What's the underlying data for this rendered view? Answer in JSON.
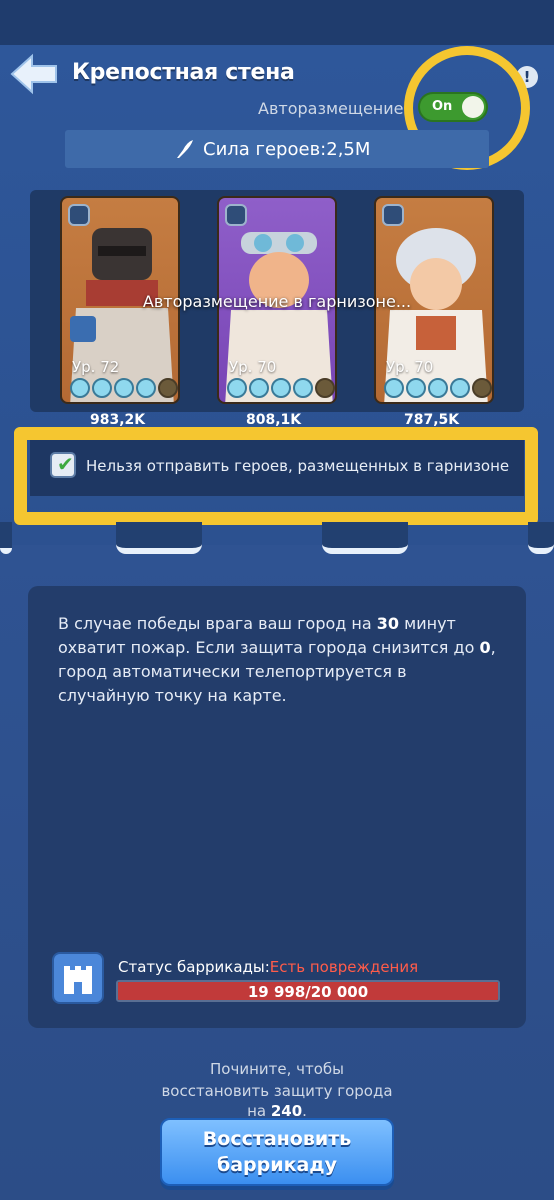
{
  "header": {
    "title": "Крепостная стена",
    "info_glyph": "!"
  },
  "auto_placement": {
    "label": "Авторазмещение",
    "toggle_text": "On",
    "enabled": true
  },
  "hero_power": {
    "label": "Сила героев:2,5M"
  },
  "heroes": [
    {
      "level": "Ур. 72",
      "power": "983,2K",
      "stars_filled": 4,
      "stars_total": 5
    },
    {
      "level": "Ур. 70",
      "power": "808,1K",
      "stars_filled": 4,
      "stars_total": 5
    },
    {
      "level": "Ур. 70",
      "power": "787,5K",
      "stars_filled": 4,
      "stars_total": 5
    }
  ],
  "overlay_message": "Авторазмещение в гарнизоне...",
  "notice": {
    "checked": true,
    "text": "Нельзя отправить героев, размещенных в гарнизоне"
  },
  "info": {
    "line1_a": "В случае победы врага ваш город на ",
    "line1_b": "30",
    "line1_c": " минут",
    "line2_a": "охватит пожар. Если защита города снизится до ",
    "line2_b": "0",
    "line2_c": ",",
    "line3": "город автоматически телепортируется в",
    "line4": "случайную точку на карте."
  },
  "barricade": {
    "status_label": "Статус баррикады:",
    "status_value": "Есть повреждения",
    "count": "19 998/20 000",
    "fraction": 0.9999
  },
  "repair": {
    "line1": "Почините, чтобы",
    "line2": "восстановить защиту города",
    "line3_a": "на ",
    "line3_b": "240",
    "line3_c": "."
  },
  "restore_button": {
    "line1": "Восстановить",
    "line2": "баррикаду"
  },
  "colors": {
    "accent_highlight": "#f5c630",
    "toggle_on": "#3d9a2f",
    "damage_red": "#ff5c4a",
    "button_blue": "#3b8ff0"
  }
}
